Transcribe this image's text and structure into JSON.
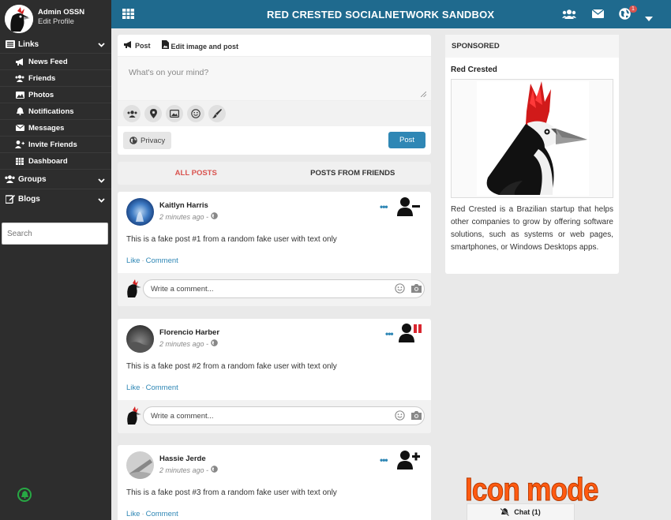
{
  "app": {
    "title": "RED CRESTED SOCIALNETWORK SANDBOX",
    "notification_count": "1"
  },
  "profile": {
    "name": "Admin OSSN",
    "edit_label": "Edit Profile"
  },
  "sidebar": {
    "links_label": "Links",
    "items": [
      "News Feed",
      "Friends",
      "Photos",
      "Notifications",
      "Messages",
      "Invite Friends",
      "Dashboard"
    ],
    "groups_label": "Groups",
    "blogs_label": "Blogs",
    "search_placeholder": "Search"
  },
  "composer": {
    "tab_post": "Post",
    "tab_edit_image": "Edit image and post",
    "placeholder": "What's on your mind?",
    "privacy_label": "Privacy",
    "post_label": "Post"
  },
  "feed_tabs": {
    "all": "ALL POSTS",
    "friends": "POSTS FROM FRIENDS"
  },
  "posts": [
    {
      "author": "Kaitlyn Harris",
      "time": "2 minutes ago -",
      "text": "This is a fake post #1 from a random fake user with text only",
      "like": "Like",
      "comment": "Comment",
      "comment_placeholder": "Write a comment..."
    },
    {
      "author": "Florencio Harber",
      "time": "2 minutes ago -",
      "text": "This is a fake post #2 from a random fake user with text only",
      "like": "Like",
      "comment": "Comment",
      "comment_placeholder": "Write a comment..."
    },
    {
      "author": "Hassie Jerde",
      "time": "2 minutes ago -",
      "text": "This is a fake post #3 from a random fake user with text only",
      "like": "Like",
      "comment": "Comment",
      "comment_placeholder": "Write a comment..."
    }
  ],
  "sponsored": {
    "heading": "SPONSORED",
    "title": "Red Crested",
    "text": "Red Crested is a Brazilian startup that helps other companies to grow by offering software solutions, such as systems or web pages, smartphones, or Windows Desktops apps."
  },
  "overlay_label": "Icon mode",
  "chat_label": "Chat (1)",
  "colors": {
    "topbar": "#1f6a8e",
    "sidebar": "#2d2d2d",
    "accent": "#2f87b5",
    "active_tab": "#d9534f"
  }
}
